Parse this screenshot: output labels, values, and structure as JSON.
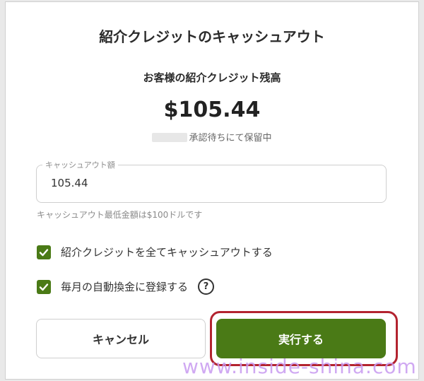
{
  "dialog": {
    "title": "紹介クレジットのキャッシュアウト",
    "subtitle": "お客様の紹介クレジット残高",
    "balance": "$105.44",
    "pending_text": "承認待ちにて保留中"
  },
  "form": {
    "amount_label": "キャッシュアウト額",
    "amount_value": "105.44",
    "hint": "キャッシュアウト最低金額は$100ドルです",
    "checkbox_all_label": "紹介クレジットを全てキャッシュアウトする",
    "checkbox_all_checked": true,
    "checkbox_auto_label": "毎月の自動換金に登録する",
    "checkbox_auto_checked": true,
    "help_icon_glyph": "?"
  },
  "buttons": {
    "cancel_label": "キャンセル",
    "submit_label": "実行する"
  },
  "colors": {
    "accent": "#4a7a16",
    "highlight_ring": "#b3232f",
    "watermark": "#c89bf0"
  },
  "watermark": {
    "text": "www.inside-shina.com"
  }
}
